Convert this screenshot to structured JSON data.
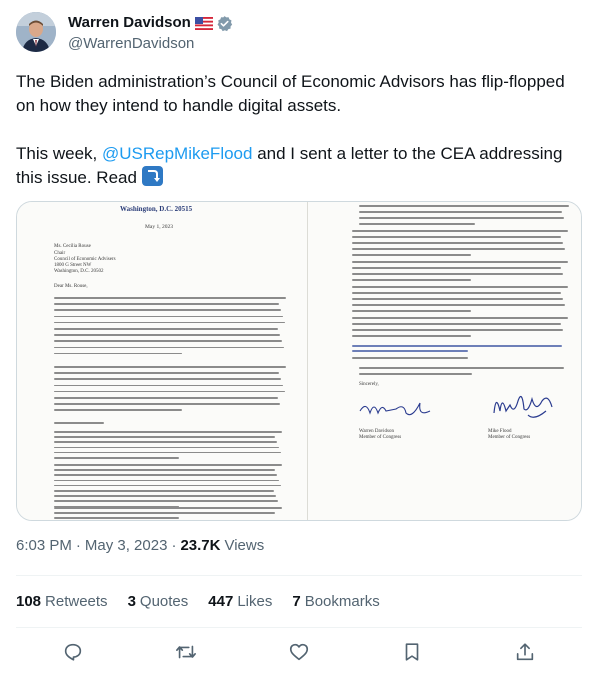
{
  "author": {
    "display_name": "Warren Davidson",
    "handle": "@WarrenDavidson",
    "flag_icon": "us-flag-icon",
    "badge_icon": "verified-badge-icon",
    "badge_color": "#829aab"
  },
  "tweet": {
    "line1": "The Biden administration’s Council of Economic Advisors has flip-flopped on how they intend to handle digital assets.",
    "line2_pre": "This week, ",
    "mention": "@USRepMikeFlood",
    "line2_post": " and I sent a letter to the CEA addressing this issue. Read ",
    "arrow_emoji": "right-arrow-curving-down-emoji"
  },
  "media": {
    "letterhead": "Washington, D.C. 20515",
    "date": "May 1, 2023",
    "recipient": [
      "Ms. Cecilia Rouse",
      "Chair",
      "Council of Economic Advisers",
      "1800 G Street NW",
      "Washington, D.C. 20502"
    ],
    "salutation": "Dear Ms. Rouse,",
    "closing": "Sincerely,",
    "signer1_name": "Warren Davidson",
    "signer1_title": "Member of Congress",
    "signer2_name": "Mike Flood",
    "signer2_title": "Member of Congress"
  },
  "meta": {
    "time": "6:03 PM",
    "date": "May 3, 2023",
    "separator": "·",
    "views_count": "23.7K",
    "views_label": "Views"
  },
  "stats": {
    "retweets_count": "108",
    "retweets_label": "Retweets",
    "quotes_count": "3",
    "quotes_label": "Quotes",
    "likes_count": "447",
    "likes_label": "Likes",
    "bookmarks_count": "7",
    "bookmarks_label": "Bookmarks"
  },
  "colors": {
    "link_blue": "#1d9bf0",
    "text_primary": "#0f1419",
    "text_secondary": "#536471",
    "border": "#cfd9de"
  }
}
